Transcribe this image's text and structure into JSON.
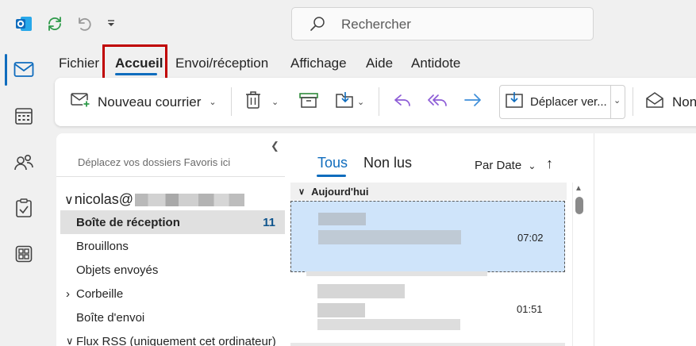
{
  "search": {
    "placeholder": "Rechercher",
    "icon": "search-icon"
  },
  "menu": {
    "tabs": [
      {
        "label": "Fichier"
      },
      {
        "label": "Accueil",
        "active": true
      },
      {
        "label": "Envoi/réception"
      },
      {
        "label": "Affichage"
      },
      {
        "label": "Aide"
      },
      {
        "label": "Antidote"
      }
    ]
  },
  "ribbon": {
    "new_mail": "Nouveau courrier",
    "move_to": "Déplacer ver...",
    "read_unread": "Non"
  },
  "folders": {
    "hint": "Déplacez vos dossiers Favoris ici",
    "account": "nicolas@",
    "items": [
      {
        "label": "Boîte de réception",
        "count": "11",
        "selected": true
      },
      {
        "label": "Brouillons"
      },
      {
        "label": "Objets envoyés"
      },
      {
        "label": "Corbeille",
        "expandable": true
      },
      {
        "label": "Boîte d'envoi"
      },
      {
        "label": "Flux RSS (uniquement cet ordinateur)",
        "expandable": true
      }
    ]
  },
  "message_list": {
    "tab_all": "Tous",
    "tab_unread": "Non lus",
    "sort": "Par Date",
    "group": "Aujourd'hui",
    "messages": [
      {
        "time": "07:02",
        "selected": true
      },
      {
        "time": "01:51"
      }
    ]
  },
  "colors": {
    "accent": "#0f6cbd",
    "highlight": "#c00000",
    "selection": "#cfe4fa"
  }
}
